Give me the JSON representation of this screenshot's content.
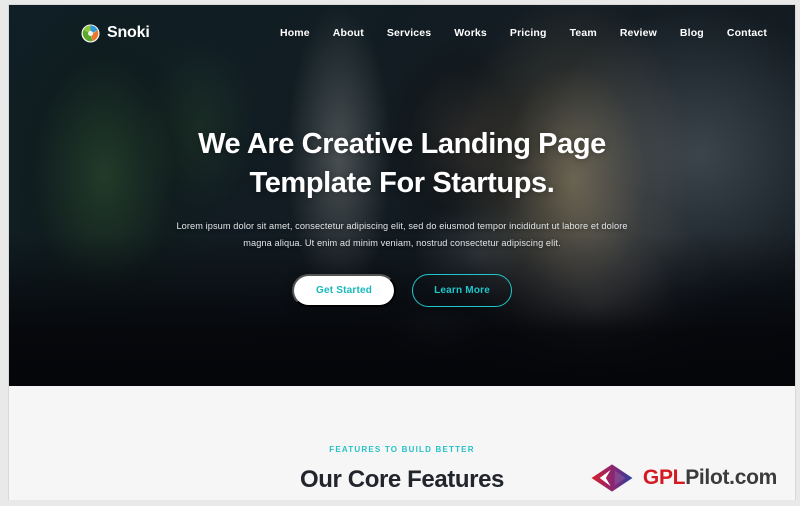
{
  "site": {
    "brand_name": "Snoki",
    "brand_logo_icon": "snoki-swirl-logo-icon",
    "accent_color": "#1fc6cb",
    "eyebrow_color": "#26c2c7",
    "dark_overlay_color": "#14181e",
    "section_bg_color": "#f6f6f6"
  },
  "nav": {
    "items": [
      {
        "label": "Home",
        "active": true
      },
      {
        "label": "About",
        "active": false
      },
      {
        "label": "Services",
        "active": false
      },
      {
        "label": "Works",
        "active": false
      },
      {
        "label": "Pricing",
        "active": false
      },
      {
        "label": "Team",
        "active": false
      },
      {
        "label": "Review",
        "active": false
      },
      {
        "label": "Blog",
        "active": false
      },
      {
        "label": "Contact",
        "active": false
      }
    ]
  },
  "hero": {
    "title_line1": "We Are Creative Landing Page",
    "title_line2": "Template For Startups.",
    "subtitle_line1": "Lorem ipsum dolor sit amet, consectetur adipiscing elit, sed do eiusmod tempor incididunt ut labore et",
    "subtitle_line2": "dolore magna aliqua. Ut enim ad minim veniam, nostrud consectetur adipiscing elit.",
    "primary_button": "Get Started",
    "secondary_button": "Learn More",
    "background_description": "Two colleagues working together at a laptop in an office with plants"
  },
  "features": {
    "eyebrow": "FEATURES TO BUILD BETTER",
    "title": "Our Core Features"
  },
  "watermark": {
    "icon": "gplpilot-diamond-chevron-icon",
    "text_primary": "GPL",
    "text_secondary": "Pilot.com",
    "primary_color": "#d31b23",
    "secondary_color": "#3b3b3b"
  }
}
